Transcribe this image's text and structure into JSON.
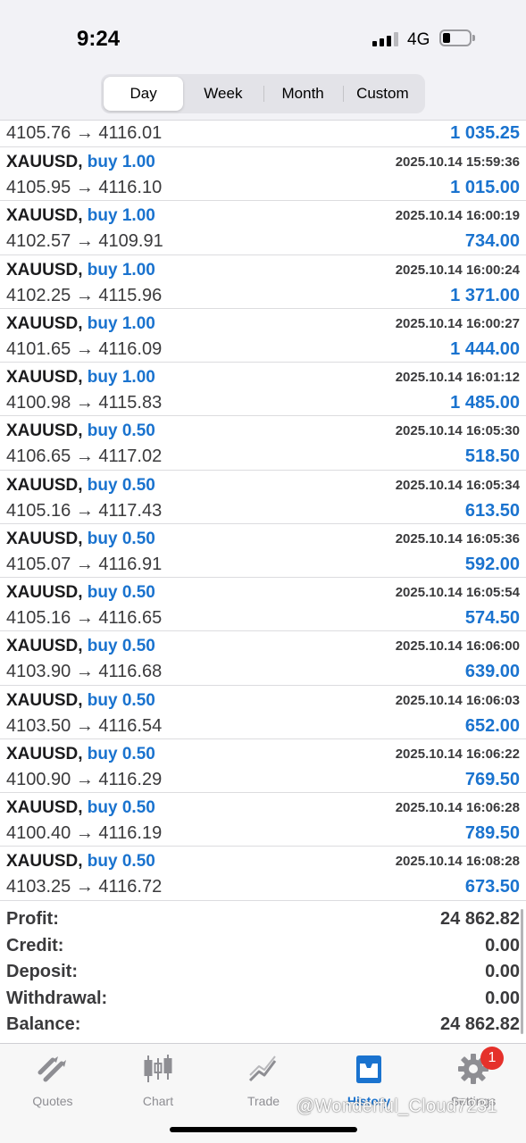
{
  "status_bar": {
    "time": "9:24",
    "network": "4G"
  },
  "segments": [
    {
      "label": "Day",
      "active": true
    },
    {
      "label": "Week",
      "active": false
    },
    {
      "label": "Month",
      "active": false
    },
    {
      "label": "Custom",
      "active": false
    }
  ],
  "partial_trade": {
    "prices": "4105.76 → 4116.01",
    "profit": "1 035.25"
  },
  "trades": [
    {
      "symbol": "XAUUSD,",
      "side": "buy 1.00",
      "time": "2025.10.14 15:59:36",
      "prices": "4105.95 → 4116.10",
      "profit": "1 015.00"
    },
    {
      "symbol": "XAUUSD,",
      "side": "buy 1.00",
      "time": "2025.10.14 16:00:19",
      "prices": "4102.57 → 4109.91",
      "profit": "734.00"
    },
    {
      "symbol": "XAUUSD,",
      "side": "buy 1.00",
      "time": "2025.10.14 16:00:24",
      "prices": "4102.25 → 4115.96",
      "profit": "1 371.00"
    },
    {
      "symbol": "XAUUSD,",
      "side": "buy 1.00",
      "time": "2025.10.14 16:00:27",
      "prices": "4101.65 → 4116.09",
      "profit": "1 444.00"
    },
    {
      "symbol": "XAUUSD,",
      "side": "buy 1.00",
      "time": "2025.10.14 16:01:12",
      "prices": "4100.98 → 4115.83",
      "profit": "1 485.00"
    },
    {
      "symbol": "XAUUSD,",
      "side": "buy 0.50",
      "time": "2025.10.14 16:05:30",
      "prices": "4106.65 → 4117.02",
      "profit": "518.50"
    },
    {
      "symbol": "XAUUSD,",
      "side": "buy 0.50",
      "time": "2025.10.14 16:05:34",
      "prices": "4105.16 → 4117.43",
      "profit": "613.50"
    },
    {
      "symbol": "XAUUSD,",
      "side": "buy 0.50",
      "time": "2025.10.14 16:05:36",
      "prices": "4105.07 → 4116.91",
      "profit": "592.00"
    },
    {
      "symbol": "XAUUSD,",
      "side": "buy 0.50",
      "time": "2025.10.14 16:05:54",
      "prices": "4105.16 → 4116.65",
      "profit": "574.50"
    },
    {
      "symbol": "XAUUSD,",
      "side": "buy 0.50",
      "time": "2025.10.14 16:06:00",
      "prices": "4103.90 → 4116.68",
      "profit": "639.00"
    },
    {
      "symbol": "XAUUSD,",
      "side": "buy 0.50",
      "time": "2025.10.14 16:06:03",
      "prices": "4103.50 → 4116.54",
      "profit": "652.00"
    },
    {
      "symbol": "XAUUSD,",
      "side": "buy 0.50",
      "time": "2025.10.14 16:06:22",
      "prices": "4100.90 → 4116.29",
      "profit": "769.50"
    },
    {
      "symbol": "XAUUSD,",
      "side": "buy 0.50",
      "time": "2025.10.14 16:06:28",
      "prices": "4100.40 → 4116.19",
      "profit": "789.50"
    },
    {
      "symbol": "XAUUSD,",
      "side": "buy 0.50",
      "time": "2025.10.14 16:08:28",
      "prices": "4103.25 → 4116.72",
      "profit": "673.50"
    }
  ],
  "summary": [
    {
      "label": "Profit:",
      "value": "24 862.82"
    },
    {
      "label": "Credit:",
      "value": "0.00"
    },
    {
      "label": "Deposit:",
      "value": "0.00"
    },
    {
      "label": "Withdrawal:",
      "value": "0.00"
    },
    {
      "label": "Balance:",
      "value": "24 862.82"
    }
  ],
  "tabs": [
    {
      "label": "Quotes",
      "icon": "quotes-icon",
      "active": false
    },
    {
      "label": "Chart",
      "icon": "candlestick-icon",
      "active": false
    },
    {
      "label": "Trade",
      "icon": "trade-icon",
      "active": false
    },
    {
      "label": "History",
      "icon": "history-inbox-icon",
      "active": true
    },
    {
      "label": "Settings",
      "icon": "gear-icon",
      "active": false
    }
  ],
  "settings_badge": "1",
  "watermark": "@Wonderful_Cloud7231",
  "colors": {
    "accent": "#1a73cf",
    "badge": "#e5312b",
    "text": "#1c1c1e",
    "secondary_text": "#3a3a3c",
    "inactive_tab": "#8e8e93"
  }
}
